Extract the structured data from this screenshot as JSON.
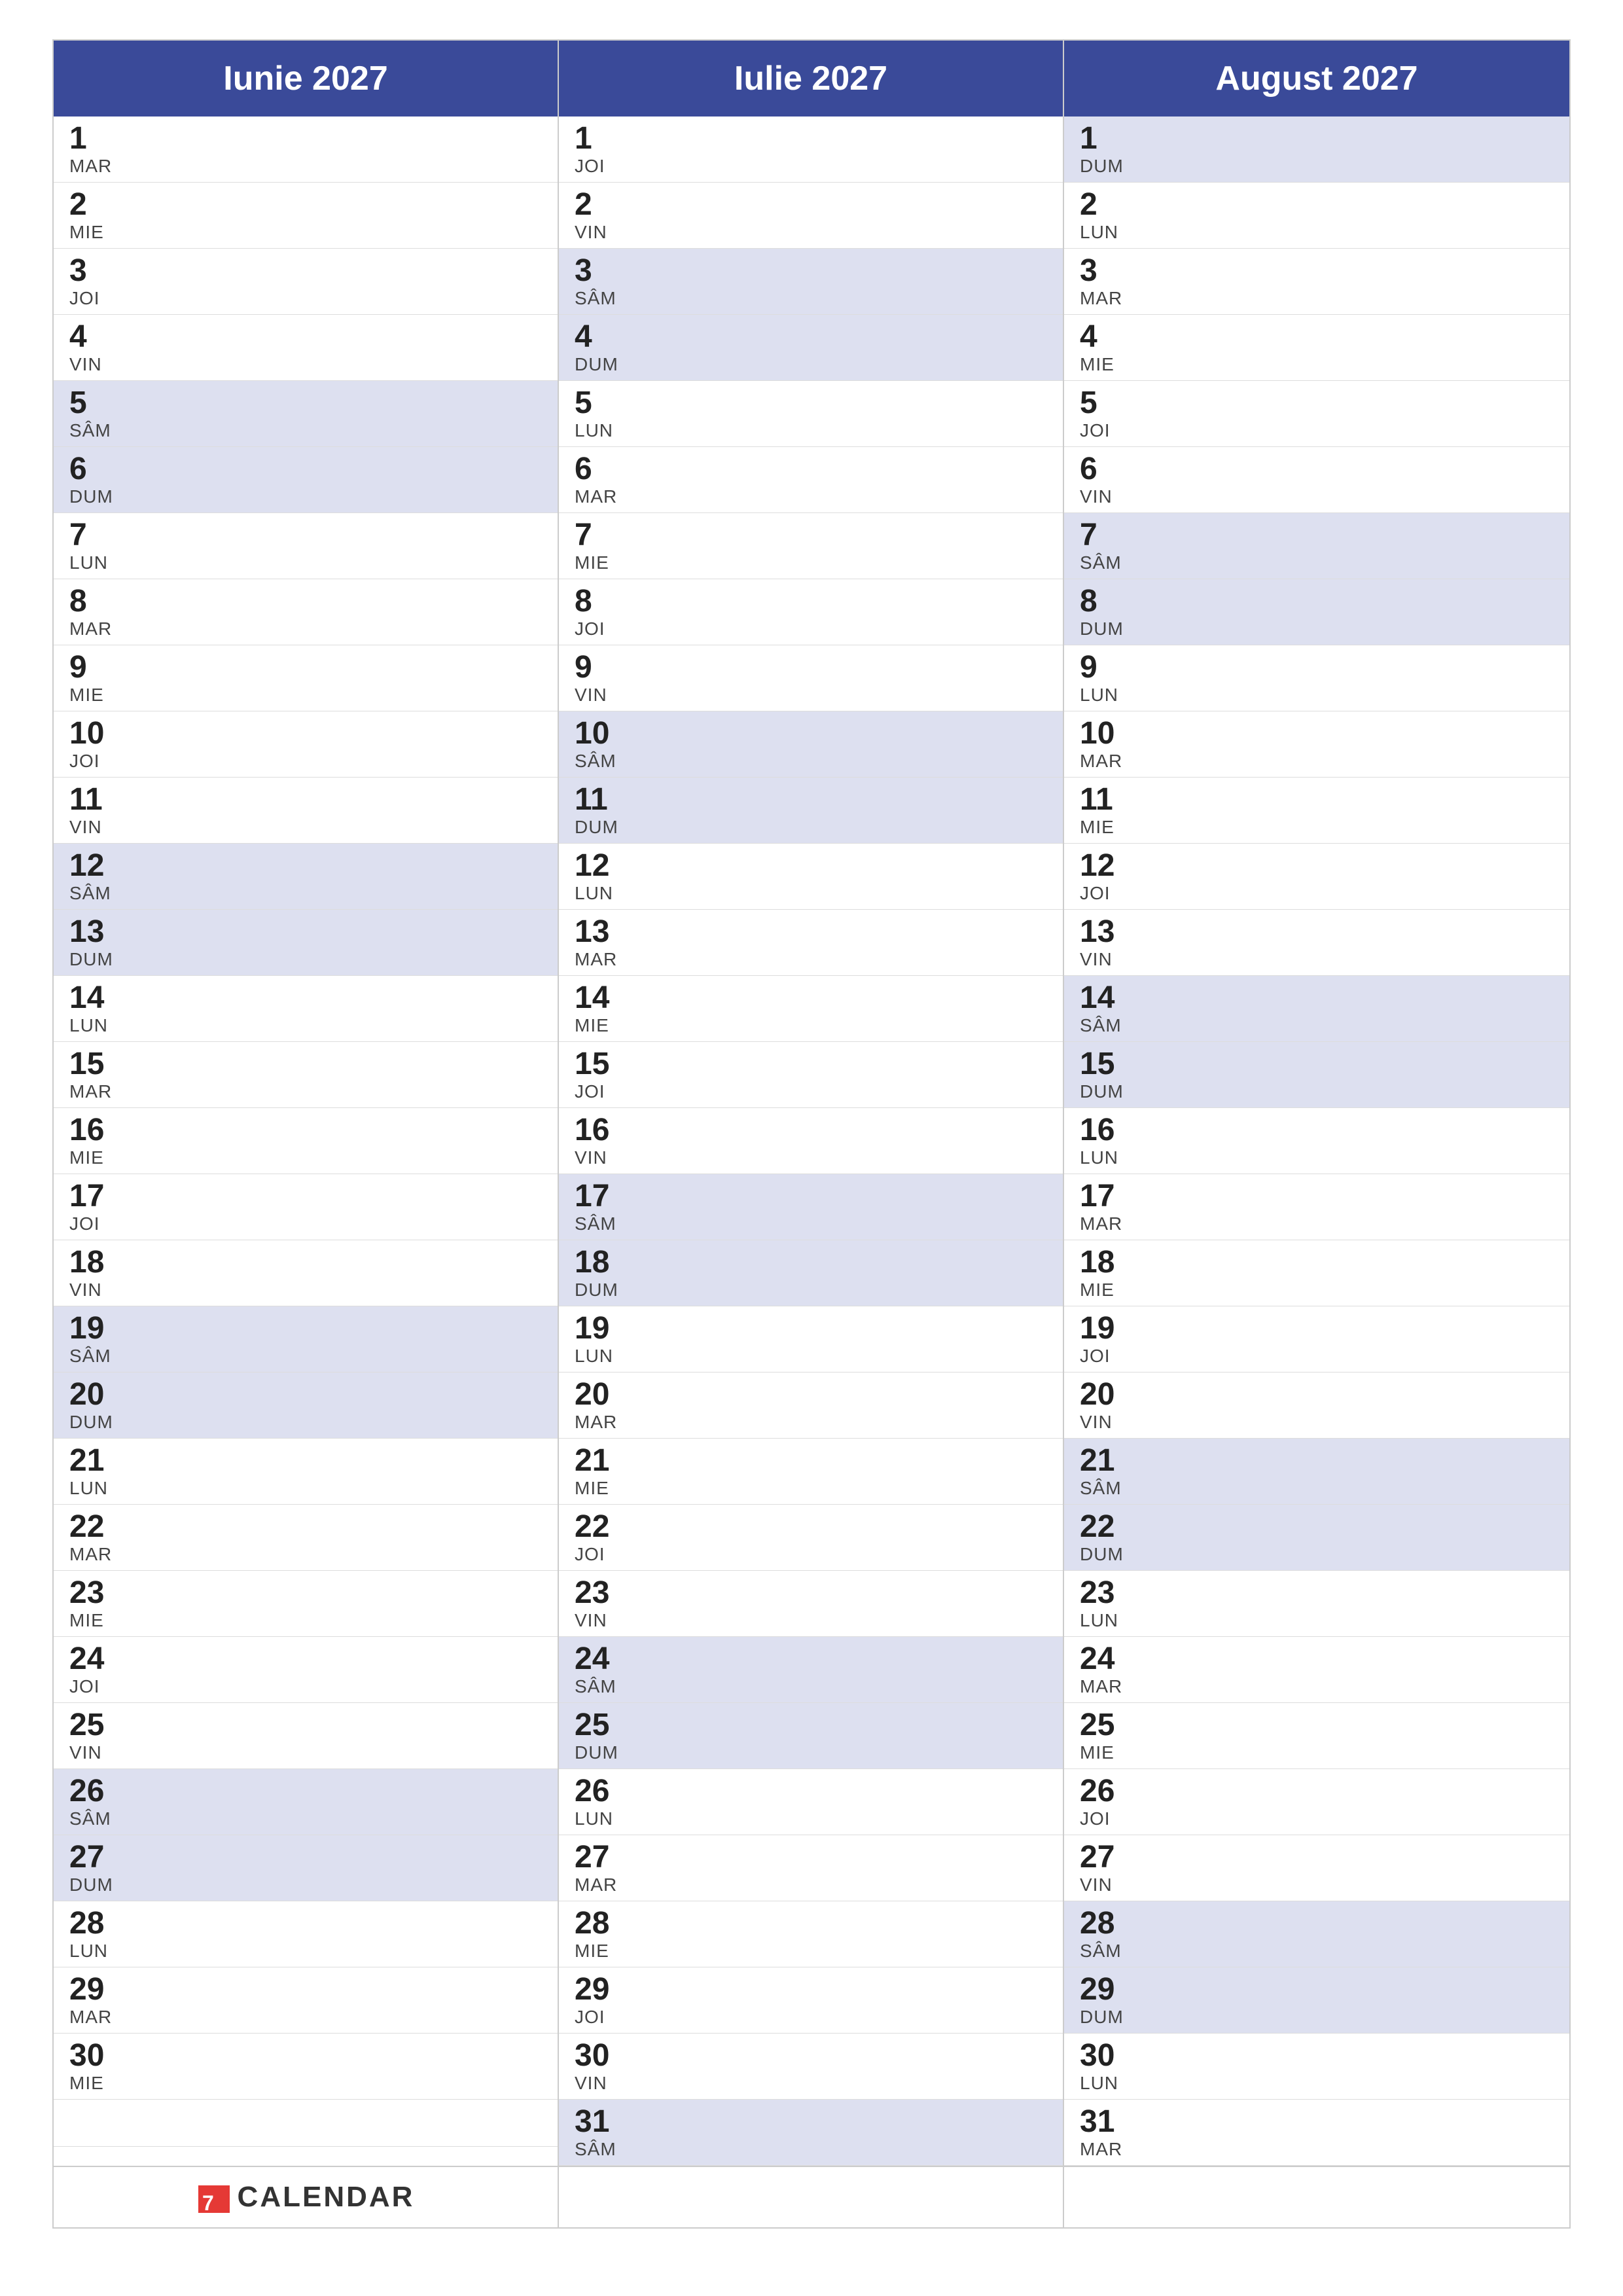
{
  "months": [
    {
      "name": "Iunie 2027",
      "days": [
        {
          "num": "1",
          "day": "MAR",
          "weekend": false
        },
        {
          "num": "2",
          "day": "MIE",
          "weekend": false
        },
        {
          "num": "3",
          "day": "JOI",
          "weekend": false
        },
        {
          "num": "4",
          "day": "VIN",
          "weekend": false
        },
        {
          "num": "5",
          "day": "SÂM",
          "weekend": true
        },
        {
          "num": "6",
          "day": "DUM",
          "weekend": true
        },
        {
          "num": "7",
          "day": "LUN",
          "weekend": false
        },
        {
          "num": "8",
          "day": "MAR",
          "weekend": false
        },
        {
          "num": "9",
          "day": "MIE",
          "weekend": false
        },
        {
          "num": "10",
          "day": "JOI",
          "weekend": false
        },
        {
          "num": "11",
          "day": "VIN",
          "weekend": false
        },
        {
          "num": "12",
          "day": "SÂM",
          "weekend": true
        },
        {
          "num": "13",
          "day": "DUM",
          "weekend": true
        },
        {
          "num": "14",
          "day": "LUN",
          "weekend": false
        },
        {
          "num": "15",
          "day": "MAR",
          "weekend": false
        },
        {
          "num": "16",
          "day": "MIE",
          "weekend": false
        },
        {
          "num": "17",
          "day": "JOI",
          "weekend": false
        },
        {
          "num": "18",
          "day": "VIN",
          "weekend": false
        },
        {
          "num": "19",
          "day": "SÂM",
          "weekend": true
        },
        {
          "num": "20",
          "day": "DUM",
          "weekend": true
        },
        {
          "num": "21",
          "day": "LUN",
          "weekend": false
        },
        {
          "num": "22",
          "day": "MAR",
          "weekend": false
        },
        {
          "num": "23",
          "day": "MIE",
          "weekend": false
        },
        {
          "num": "24",
          "day": "JOI",
          "weekend": false
        },
        {
          "num": "25",
          "day": "VIN",
          "weekend": false
        },
        {
          "num": "26",
          "day": "SÂM",
          "weekend": true
        },
        {
          "num": "27",
          "day": "DUM",
          "weekend": true
        },
        {
          "num": "28",
          "day": "LUN",
          "weekend": false
        },
        {
          "num": "29",
          "day": "MAR",
          "weekend": false
        },
        {
          "num": "30",
          "day": "MIE",
          "weekend": false
        }
      ],
      "extra": 1
    },
    {
      "name": "Iulie 2027",
      "days": [
        {
          "num": "1",
          "day": "JOI",
          "weekend": false
        },
        {
          "num": "2",
          "day": "VIN",
          "weekend": false
        },
        {
          "num": "3",
          "day": "SÂM",
          "weekend": true
        },
        {
          "num": "4",
          "day": "DUM",
          "weekend": true
        },
        {
          "num": "5",
          "day": "LUN",
          "weekend": false
        },
        {
          "num": "6",
          "day": "MAR",
          "weekend": false
        },
        {
          "num": "7",
          "day": "MIE",
          "weekend": false
        },
        {
          "num": "8",
          "day": "JOI",
          "weekend": false
        },
        {
          "num": "9",
          "day": "VIN",
          "weekend": false
        },
        {
          "num": "10",
          "day": "SÂM",
          "weekend": true
        },
        {
          "num": "11",
          "day": "DUM",
          "weekend": true
        },
        {
          "num": "12",
          "day": "LUN",
          "weekend": false
        },
        {
          "num": "13",
          "day": "MAR",
          "weekend": false
        },
        {
          "num": "14",
          "day": "MIE",
          "weekend": false
        },
        {
          "num": "15",
          "day": "JOI",
          "weekend": false
        },
        {
          "num": "16",
          "day": "VIN",
          "weekend": false
        },
        {
          "num": "17",
          "day": "SÂM",
          "weekend": true
        },
        {
          "num": "18",
          "day": "DUM",
          "weekend": true
        },
        {
          "num": "19",
          "day": "LUN",
          "weekend": false
        },
        {
          "num": "20",
          "day": "MAR",
          "weekend": false
        },
        {
          "num": "21",
          "day": "MIE",
          "weekend": false
        },
        {
          "num": "22",
          "day": "JOI",
          "weekend": false
        },
        {
          "num": "23",
          "day": "VIN",
          "weekend": false
        },
        {
          "num": "24",
          "day": "SÂM",
          "weekend": true
        },
        {
          "num": "25",
          "day": "DUM",
          "weekend": true
        },
        {
          "num": "26",
          "day": "LUN",
          "weekend": false
        },
        {
          "num": "27",
          "day": "MAR",
          "weekend": false
        },
        {
          "num": "28",
          "day": "MIE",
          "weekend": false
        },
        {
          "num": "29",
          "day": "JOI",
          "weekend": false
        },
        {
          "num": "30",
          "day": "VIN",
          "weekend": false
        },
        {
          "num": "31",
          "day": "SÂM",
          "weekend": true
        }
      ],
      "extra": 0
    },
    {
      "name": "August 2027",
      "days": [
        {
          "num": "1",
          "day": "DUM",
          "weekend": true
        },
        {
          "num": "2",
          "day": "LUN",
          "weekend": false
        },
        {
          "num": "3",
          "day": "MAR",
          "weekend": false
        },
        {
          "num": "4",
          "day": "MIE",
          "weekend": false
        },
        {
          "num": "5",
          "day": "JOI",
          "weekend": false
        },
        {
          "num": "6",
          "day": "VIN",
          "weekend": false
        },
        {
          "num": "7",
          "day": "SÂM",
          "weekend": true
        },
        {
          "num": "8",
          "day": "DUM",
          "weekend": true
        },
        {
          "num": "9",
          "day": "LUN",
          "weekend": false
        },
        {
          "num": "10",
          "day": "MAR",
          "weekend": false
        },
        {
          "num": "11",
          "day": "MIE",
          "weekend": false
        },
        {
          "num": "12",
          "day": "JOI",
          "weekend": false
        },
        {
          "num": "13",
          "day": "VIN",
          "weekend": false
        },
        {
          "num": "14",
          "day": "SÂM",
          "weekend": true
        },
        {
          "num": "15",
          "day": "DUM",
          "weekend": true
        },
        {
          "num": "16",
          "day": "LUN",
          "weekend": false
        },
        {
          "num": "17",
          "day": "MAR",
          "weekend": false
        },
        {
          "num": "18",
          "day": "MIE",
          "weekend": false
        },
        {
          "num": "19",
          "day": "JOI",
          "weekend": false
        },
        {
          "num": "20",
          "day": "VIN",
          "weekend": false
        },
        {
          "num": "21",
          "day": "SÂM",
          "weekend": true
        },
        {
          "num": "22",
          "day": "DUM",
          "weekend": true
        },
        {
          "num": "23",
          "day": "LUN",
          "weekend": false
        },
        {
          "num": "24",
          "day": "MAR",
          "weekend": false
        },
        {
          "num": "25",
          "day": "MIE",
          "weekend": false
        },
        {
          "num": "26",
          "day": "JOI",
          "weekend": false
        },
        {
          "num": "27",
          "day": "VIN",
          "weekend": false
        },
        {
          "num": "28",
          "day": "SÂM",
          "weekend": true
        },
        {
          "num": "29",
          "day": "DUM",
          "weekend": true
        },
        {
          "num": "30",
          "day": "LUN",
          "weekend": false
        },
        {
          "num": "31",
          "day": "MAR",
          "weekend": false
        }
      ],
      "extra": 0
    }
  ],
  "footer": {
    "logo_text": "CALENDAR"
  }
}
